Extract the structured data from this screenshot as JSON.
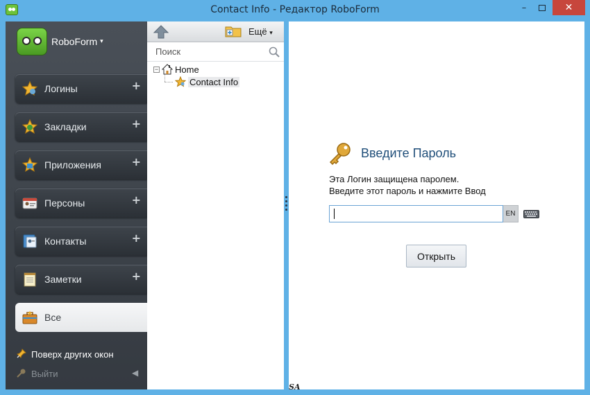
{
  "window": {
    "title": "Contact Info - Редактор RoboForm",
    "minimize": "–",
    "close": "✕"
  },
  "sidebar": {
    "brand": "RoboForm",
    "brand_caret": "▾",
    "items": [
      {
        "label": "Логины",
        "icon": "star-login-icon",
        "plus": "+"
      },
      {
        "label": "Закладки",
        "icon": "star-bookmark-icon",
        "plus": "+"
      },
      {
        "label": "Приложения",
        "icon": "star-apps-icon",
        "plus": "+"
      },
      {
        "label": "Персоны",
        "icon": "identity-card-icon",
        "plus": "+"
      },
      {
        "label": "Контакты",
        "icon": "contacts-card-icon",
        "plus": "+"
      },
      {
        "label": "Заметки",
        "icon": "notepad-icon",
        "plus": "+"
      },
      {
        "label": "Все",
        "icon": "briefcase-icon",
        "active": true
      }
    ],
    "always_on_top": "Поверх других окон",
    "logout": "Выйти",
    "logout_arrow": "◀"
  },
  "tree_pane": {
    "more_label": "Ещё",
    "more_caret": "▾",
    "search_placeholder": "Поиск",
    "tree": {
      "root": {
        "label": "Home",
        "expander": "−"
      },
      "child": {
        "label": "Contact Info"
      }
    }
  },
  "content": {
    "title": "Введите Пароль",
    "message_line1": "Эта Логин защищена паролем.",
    "message_line2": "Введите этот пароль и нажмите Ввод",
    "password_value": "",
    "language": "EN",
    "open_button": "Открыть"
  },
  "watermark": "SA",
  "colors": {
    "frame": "#5fb1e6",
    "sidebar": "#3c4249",
    "title_blue": "#1f4e79",
    "close_red": "#c7463c"
  }
}
